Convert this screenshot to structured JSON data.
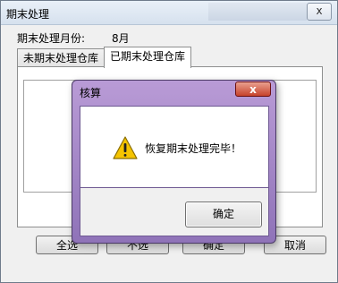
{
  "window": {
    "title": "期末处理",
    "close_glyph": "x"
  },
  "form": {
    "month_label": "期末处理月份:",
    "month_value": "8月"
  },
  "tabs": [
    {
      "label": "未期末处理仓库",
      "active": false
    },
    {
      "label": "已期末处理仓库",
      "active": true
    }
  ],
  "buttons": {
    "select_all": "全选",
    "deselect": "不选",
    "confirm": "确定",
    "cancel": "取消"
  },
  "dialog": {
    "title": "核算",
    "close_glyph": "x",
    "icon": "warning-icon",
    "message": "恢复期末处理完毕！",
    "ok_label": "确定"
  },
  "colors": {
    "dialog_frame": "#a488c8",
    "close_red": "#c7422b",
    "warning_yellow": "#f5c400"
  }
}
